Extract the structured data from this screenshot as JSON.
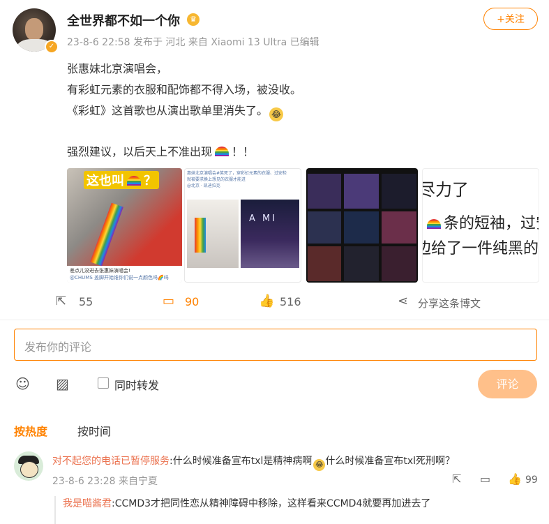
{
  "post": {
    "username": "全世界都不如一个你",
    "timestamp": "23-8-6 22:58",
    "published_from": "发布于 河北",
    "device": "来自 Xiaomi 13 Ultra",
    "edited": "已编辑",
    "follow_label": "+关注",
    "lines": [
      "张惠妹北京演唱会，",
      "有彩虹元素的衣服和配饰都不得入场，被没收。",
      "《彩虹》这首歌也从演出歌单里消失了。",
      "强烈建议，以后天上不准出现",
      "！！"
    ],
    "images": {
      "img1_caption": "这也叫",
      "img1_question": "？",
      "img1_bottom": "差点儿没进去张惠妹演唱会!",
      "img1_bottom2": "@CHUMS 盖脚开始谁你们说一点颜色吗🌈吗",
      "img2_top": "惠妹北京演唱会#笑死了，穿彩虹元素的衣服、过安检",
      "img2_top2": "就被要求换上想见的衣服才能进",
      "img2_location": "@北京 · 凯迪拉克",
      "img2_stage_text": "A MI",
      "img4_line1": "尽力了",
      "img4_line2": "条的短袖，过安",
      "img4_line3": "边给了一件纯黑的"
    },
    "actions": {
      "repost_count": "55",
      "comment_count": "90",
      "like_count": "516",
      "share_label": "分享这条博文"
    }
  },
  "composer": {
    "placeholder": "发布你的评论",
    "also_repost_label": "同时转发",
    "submit_label": "评论"
  },
  "sort": {
    "by_hot": "按热度",
    "by_time": "按时间"
  },
  "comments": [
    {
      "name": "对不起您的电话已暂停服务",
      "text_part1": ":什么时候准备宣布txl是精神病啊",
      "text_part2": "什么时候准备宣布txl死刑啊？",
      "time": "23-8-6 23:28",
      "location": "来自宁夏",
      "like_count": "99",
      "reply": {
        "name": "我是喵酱君",
        "text": ":CCMD3才把同性恋从精神障碍中移除，这样看来CCMD4就要再加进去了"
      }
    }
  ],
  "icons": {
    "verified": "verified-badge-icon",
    "crown": "crown-icon",
    "repost": "repost-icon",
    "comment": "comment-icon",
    "like": "thumbs-up-icon",
    "share": "share-icon",
    "emoji_picker": "emoji-icon",
    "image_picker": "image-icon"
  },
  "colors": {
    "accent": "#ff8200",
    "name_link": "#eb7350",
    "submit_disabled": "#ffc08a"
  }
}
